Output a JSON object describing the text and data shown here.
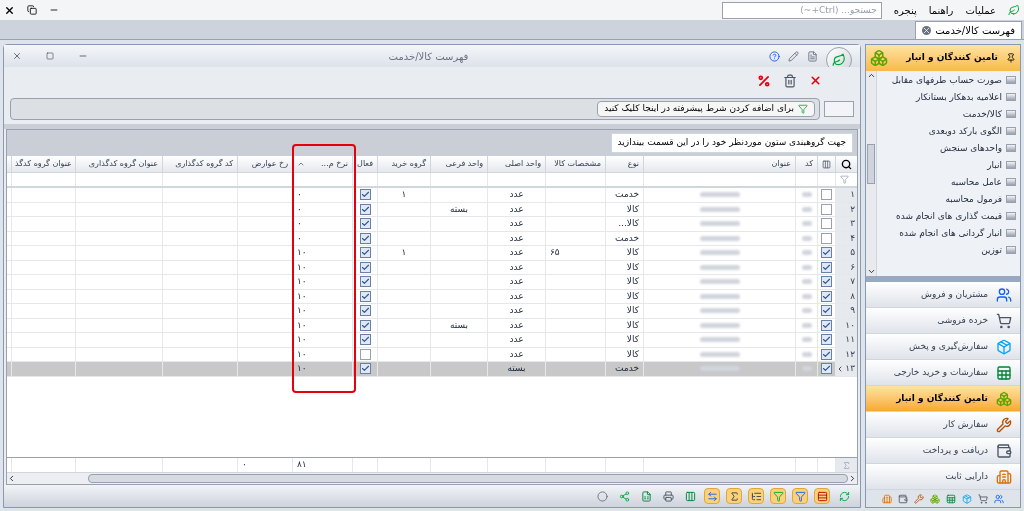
{
  "menu": [
    {
      "label": "عملیات"
    },
    {
      "label": "راهنما"
    },
    {
      "label": "پنجره"
    }
  ],
  "search": {
    "placeholder": "جستجو... (Ctrl+~)"
  },
  "tabs": [
    {
      "label": "فهرست کالا/خدمت",
      "selected": true
    }
  ],
  "window": {
    "title": "فهرست کالا/خدمت"
  },
  "filter_button": "برای اضافه کردن شرط پیشرفته در اینجا کلیک کنید",
  "group_panel": "جهت گروهبندی ستون موردنظر خود را در این قسمت بیندازید",
  "columns": [
    {
      "label": "کد",
      "sorted": false,
      "highlight": false
    },
    {
      "label": "عنوان",
      "sorted": false,
      "highlight": false
    },
    {
      "label": "نوع",
      "sorted": false,
      "highlight": false
    },
    {
      "label": "مشخصات کالا",
      "sorted": false,
      "highlight": false
    },
    {
      "label": "واحد اصلی",
      "sorted": false,
      "highlight": false
    },
    {
      "label": "واحد فرعی",
      "sorted": false,
      "highlight": false
    },
    {
      "label": "گروه خرید",
      "sorted": false,
      "highlight": false
    },
    {
      "label": "فعال",
      "sorted": false,
      "highlight": false
    },
    {
      "label": "نرخ م...",
      "sorted": true,
      "highlight": true
    },
    {
      "label": "رخ عوارض",
      "sorted": false,
      "highlight": false
    },
    {
      "label": "کد گروه کدگذاری",
      "sorted": false,
      "highlight": false
    },
    {
      "label": "عنوان گروه کدگذاری",
      "sorted": false,
      "highlight": false
    },
    {
      "label": "عنوان گروه کدگذ",
      "sorted": false,
      "highlight": false
    }
  ],
  "rows": [
    {
      "number": "۱",
      "selected": false,
      "checked": false,
      "type": "خدمت",
      "main_unit": "عدد",
      "purchase_group": "۱",
      "active": true,
      "rate": "۰"
    },
    {
      "number": "۲",
      "selected": false,
      "checked": false,
      "type": "کالا",
      "main_unit": "عدد",
      "sub_unit": "بسته",
      "active": true,
      "rate": "۰"
    },
    {
      "number": "۳",
      "selected": false,
      "checked": false,
      "type": "کالا...",
      "main_unit": "عدد",
      "active": true,
      "rate": "۰"
    },
    {
      "number": "۴",
      "selected": false,
      "checked": false,
      "type": "خدمت",
      "main_unit": "عدد",
      "active": true,
      "rate": "۰"
    },
    {
      "number": "۵",
      "selected": false,
      "checked": true,
      "type": "کالا",
      "spec": "۶۵",
      "main_unit": "عدد",
      "purchase_group": "۱",
      "active": true,
      "rate": "۱۰"
    },
    {
      "number": "۶",
      "selected": false,
      "checked": true,
      "type": "کالا",
      "main_unit": "عدد",
      "active": true,
      "rate": "۱۰"
    },
    {
      "number": "۷",
      "selected": false,
      "checked": true,
      "type": "کالا",
      "main_unit": "عدد",
      "active": true,
      "rate": "۱۰"
    },
    {
      "number": "۸",
      "selected": false,
      "checked": true,
      "type": "کالا",
      "main_unit": "عدد",
      "active": true,
      "rate": "۱۰"
    },
    {
      "number": "۹",
      "selected": false,
      "checked": true,
      "type": "کالا",
      "main_unit": "عدد",
      "active": true,
      "rate": "۱۰"
    },
    {
      "number": "۱۰",
      "selected": false,
      "checked": true,
      "type": "کالا",
      "main_unit": "عدد",
      "sub_unit": "بسته",
      "active": true,
      "rate": "۱۰"
    },
    {
      "number": "۱۱",
      "selected": false,
      "checked": true,
      "type": "کالا",
      "main_unit": "عدد",
      "active": true,
      "rate": "۱۰"
    },
    {
      "number": "۱۲",
      "selected": false,
      "checked": true,
      "type": "کالا",
      "main_unit": "عدد",
      "active": false,
      "rate": "۱۰"
    },
    {
      "number": "۱۳",
      "selected": true,
      "checked": true,
      "type": "خدمت",
      "main_unit": "بسته",
      "active": true,
      "rate": "۱۰"
    }
  ],
  "totals": {
    "rate": "۸۱",
    "levy_rate": "۰"
  },
  "bottom_toolbar": [
    {
      "kind": "refresh",
      "on": false
    },
    {
      "kind": "layout",
      "on": true
    },
    {
      "kind": "filter",
      "on": true
    },
    {
      "kind": "filter_alt",
      "on": true
    },
    {
      "kind": "group",
      "on": true
    },
    {
      "kind": "sum",
      "on": true
    },
    {
      "kind": "fit",
      "on": true
    },
    {
      "kind": "columns",
      "on": false
    },
    {
      "kind": "print",
      "on": false
    },
    {
      "kind": "excel",
      "on": false
    },
    {
      "kind": "export",
      "on": false
    },
    {
      "kind": "zoom",
      "on": false
    }
  ],
  "sidebar": {
    "title": "تامین کنندگان و انبار",
    "items": [
      {
        "label": "صورت حساب طرفهای مقابل"
      },
      {
        "label": "اعلامیه بدهکار بستانکار"
      },
      {
        "label": "کالا/خدمت"
      },
      {
        "label": "الگوی بارکد دوبعدی"
      },
      {
        "label": "واحدهای سنجش"
      },
      {
        "label": "انبار"
      },
      {
        "label": "عامل محاسبه"
      },
      {
        "label": "فرمول محاسبه"
      },
      {
        "label": "قیمت گذاری های انجام شده"
      },
      {
        "label": "انبار گردانی های انجام شده"
      },
      {
        "label": "توزین"
      }
    ],
    "sections": [
      {
        "label": "مشتریان و فروش",
        "selected": false
      },
      {
        "label": "خرده فروشی",
        "selected": false
      },
      {
        "label": "سفارش‌گیری و پخش",
        "selected": false
      },
      {
        "label": "سفارشات و خرید خارجی",
        "selected": false
      },
      {
        "label": "تامین کنندگان و انبار",
        "selected": true
      },
      {
        "label": "سفارش کار",
        "selected": false
      },
      {
        "label": "دریافت و پرداخت",
        "selected": false
      },
      {
        "label": "دارایی ثابت",
        "selected": false
      }
    ]
  }
}
